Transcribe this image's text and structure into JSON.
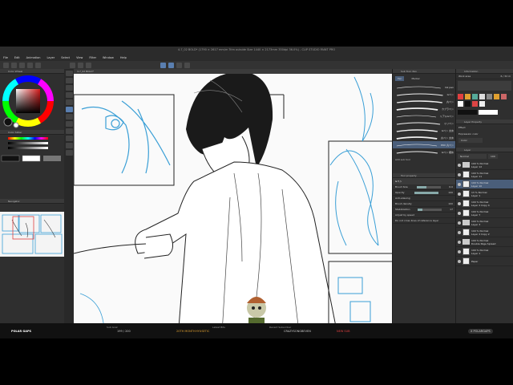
{
  "window": {
    "title": "4-7_02 BOLD* (1790 × 2617 mm/m Trim outside Size 1440 × 2173mm 350dpi 36.0%) - CLIP STUDIO PAINT PRO"
  },
  "menu": [
    "File",
    "Edit",
    "Animation",
    "Layer",
    "Select",
    "View",
    "Filter",
    "Window",
    "Help"
  ],
  "left_panel": {
    "color_wheel_tab": "Color Wheel",
    "color_slider_tab": "Color Slider",
    "navigator_tab": "Navigator"
  },
  "canvas": {
    "tab_label": "4-7_02 BOLD*"
  },
  "subtool": {
    "tab_label": "Sub Tool: Pen",
    "groups": [
      "Pen",
      "Marker"
    ],
    "brushes": [
      {
        "label": "Ink pen"
      },
      {
        "label": "Gペン"
      },
      {
        "label": "丸ペン"
      },
      {
        "label": "カブラペン"
      },
      {
        "label": "リアルGペン"
      },
      {
        "label": "ミリペン"
      },
      {
        "label": "Gペン 太め"
      },
      {
        "label": "丸ペン 太め"
      },
      {
        "label": "PRO 丸ペン"
      },
      {
        "label": "Gペン 細め"
      }
    ],
    "add_label": "Add sub tool"
  },
  "tool_property": {
    "tab_label": "Tool property",
    "title": "Gペン",
    "rows": [
      {
        "label": "Brush Size",
        "value": "6.0"
      },
      {
        "label": "Opacity",
        "value": "100"
      },
      {
        "label": "Anti-aliasing",
        "value": ""
      },
      {
        "label": "Brush density",
        "value": "100"
      },
      {
        "label": "Stabilization",
        "value": "17"
      },
      {
        "label": "Adjust by speed",
        "value": ""
      },
      {
        "label": "Do not cross lines of reference layer",
        "value": ""
      }
    ],
    "brush_size_fill": 0.4,
    "opacity_fill": 1.0,
    "stabilization_fill": 0.2
  },
  "right_panel": {
    "info_tab": "Information",
    "memory": {
      "label": "Work area",
      "value": "6 / 32 m"
    },
    "layer_property_tab": "Layer Property",
    "effect_label": "Effect",
    "expression_label": "Expression color",
    "expression_value": "Color",
    "layer_tab": "Layer",
    "blend_mode": "Normal",
    "opacity": "100",
    "layers": [
      {
        "name": "100 % Normal",
        "sub": "Layer 12",
        "type": "folder"
      },
      {
        "name": "100 % Normal",
        "sub": "Layer 11",
        "type": "layer"
      },
      {
        "name": "100 % Normal",
        "sub": "Layer 10",
        "type": "layer",
        "selected": true
      },
      {
        "name": "13 % Normal",
        "sub": "Layer 1",
        "type": "layer"
      },
      {
        "name": "100 % Normal",
        "sub": "Layer 2 Copy 4",
        "type": "layer"
      },
      {
        "name": "100 % Normal",
        "sub": "Layer 7",
        "type": "layer"
      },
      {
        "name": "100 % Normal",
        "sub": "Layer 3",
        "type": "folder"
      },
      {
        "name": "100 % Normal",
        "sub": "Layer 2 Copy 2",
        "type": "layer"
      },
      {
        "name": "100 % Normal",
        "sub": "Double Page Spread",
        "type": "folder"
      },
      {
        "name": "100 % Normal",
        "sub": "Layer 1",
        "type": "layer"
      },
      {
        "name": "",
        "sub": "Paper",
        "type": "paper"
      }
    ]
  },
  "stream": {
    "channel": "POLAR GAPS",
    "subs_label": "Sub Goal",
    "subs_value": "199 / 200",
    "month_label": "20TH MONTH",
    "month_value": "HYUSETIC",
    "latest_label": "Latest Bits",
    "recent_label": "Recent Subscriber",
    "recent_value": "CRAZYSONGBEVEN",
    "recent_tag": "NEW SUB",
    "badge": "X POLARGAPS"
  },
  "colors": {
    "ui_bg": "#2f2f2f",
    "selection": "#4a5e7a",
    "sketch_blue": "#3a9fd6",
    "accent_red": "#e04040",
    "accent_gold": "#e0a030"
  }
}
